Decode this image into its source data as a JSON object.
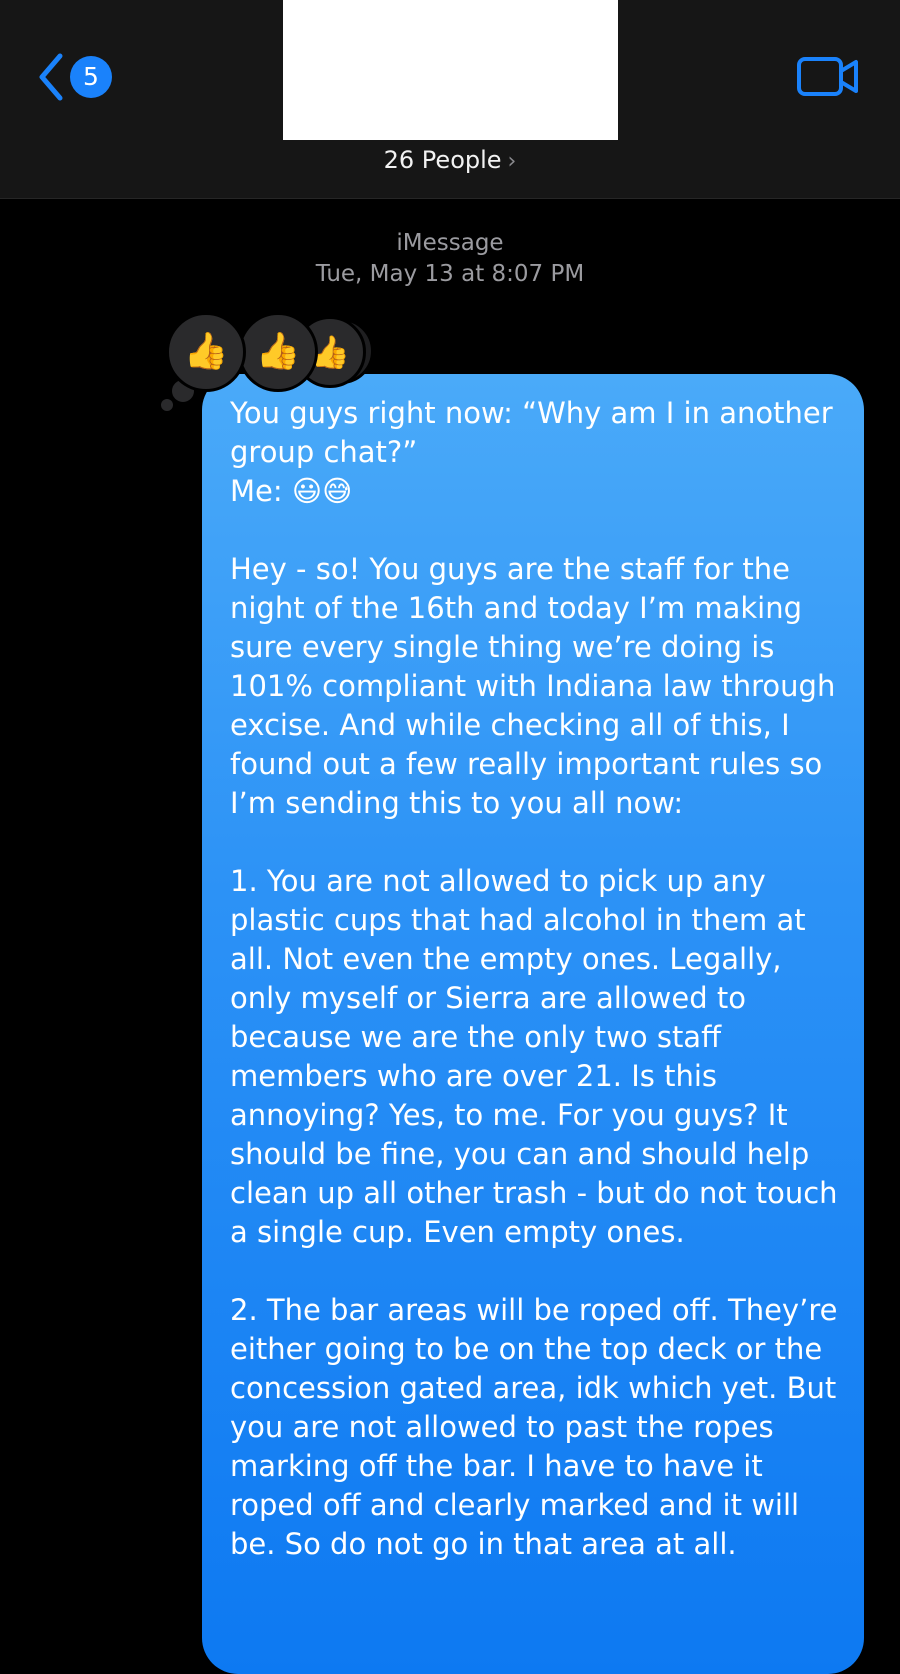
{
  "header": {
    "back_badge_count": "5",
    "people_label": "26 People",
    "chevron_right": "›"
  },
  "thread": {
    "service": "iMessage",
    "timestamp": "Tue, May 13 at 8:07 PM"
  },
  "reactions": [
    "👍",
    "👍",
    "👍"
  ],
  "message": {
    "text": "You guys right now: “Why am I in another group chat?”\nMe: 😃😅\n\nHey - so! You guys are the staff for the night of the 16th and today I’m making sure every single thing we’re doing is 101% compliant with Indiana law through excise. And while checking all of this, I found out a few really important rules so I’m sending this to you all now:\n\n1. You are not allowed to pick up any plastic cups that had alcohol in them at all. Not even the empty ones. Legally, only myself or Sierra are allowed to because we are the only two staff members who are over 21. Is this annoying? Yes, to me. For you guys? It should be fine, you can and should help clean up all other trash - but do not touch a single cup. Even empty ones.\n\n2. The bar areas will be roped off. They’re either going to be on the top deck or the concession gated area, idk which yet. But you are not allowed to past the ropes marking off the bar. I have to have it roped off and clearly marked and it will be. So do not go in that area at all."
  },
  "colors": {
    "accent": "#1a82fb",
    "bubble_top": "#4aaaf9",
    "bubble_bottom": "#0d79f2",
    "header_bg": "#161616",
    "meta_text": "#9b9ba0"
  }
}
